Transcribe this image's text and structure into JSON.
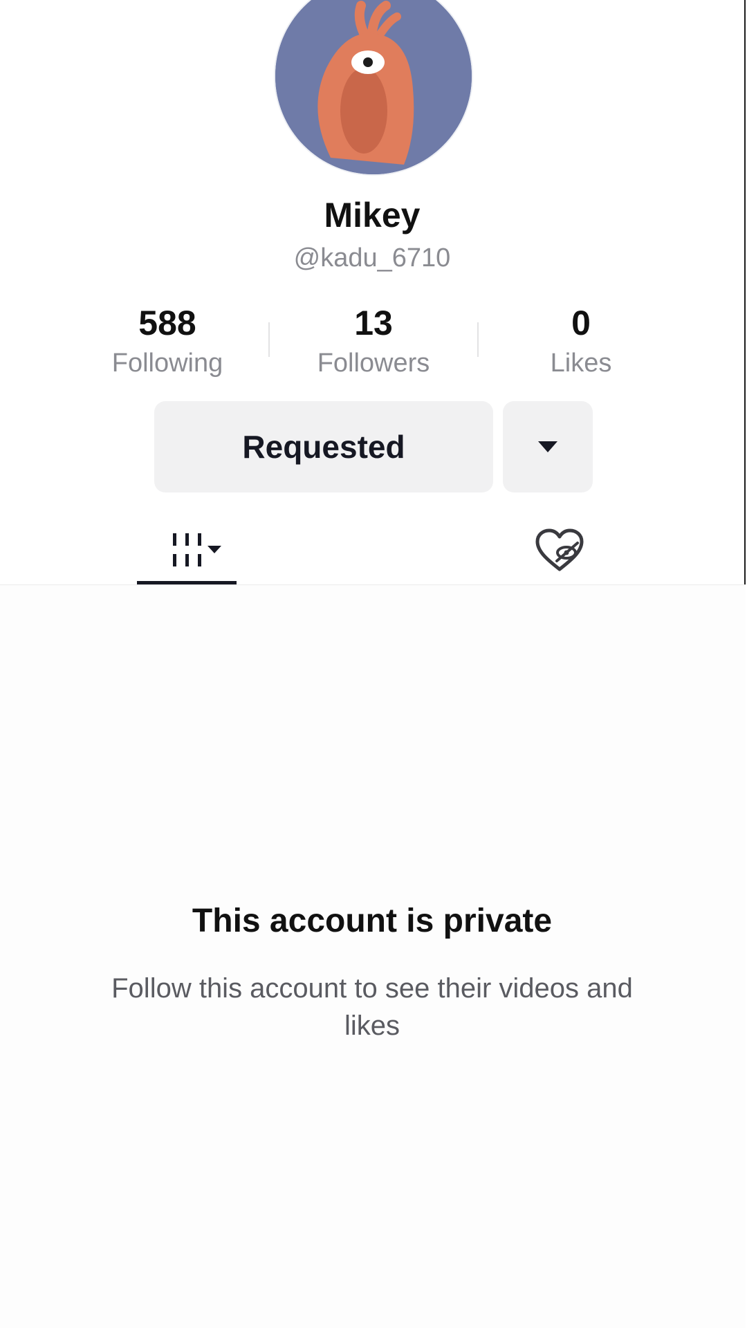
{
  "profile": {
    "display_name": "Mikey",
    "username": "@kadu_6710",
    "avatar_icon": "cartoon-creature-avatar",
    "avatar_bg_color": "#6f7ba8"
  },
  "stats": {
    "following": {
      "value": "588",
      "label": "Following"
    },
    "followers": {
      "value": "13",
      "label": "Followers"
    },
    "likes": {
      "value": "0",
      "label": "Likes"
    }
  },
  "actions": {
    "requested_label": "Requested",
    "more_icon": "caret-down-icon"
  },
  "tabs": [
    {
      "name": "videos",
      "icon": "videos-grid-dropdown-icon",
      "active": true
    },
    {
      "name": "liked",
      "icon": "hidden-liked-heart-icon",
      "active": false
    }
  ],
  "private_notice": {
    "title": "This account is private",
    "subtitle": "Follow this account to see their videos and likes"
  },
  "colors": {
    "text_primary": "#161823",
    "text_secondary": "#8a8b91",
    "button_bg": "#f1f1f2"
  }
}
